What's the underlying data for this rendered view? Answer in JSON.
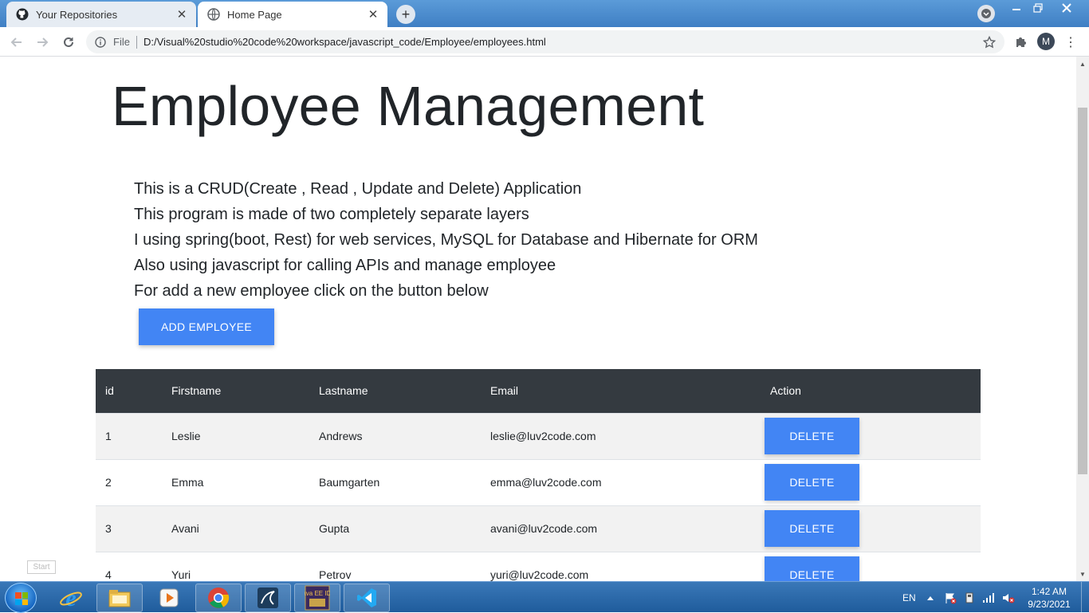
{
  "browser": {
    "tabs": [
      {
        "title": "Your Repositories",
        "icon": "github-icon",
        "active": false
      },
      {
        "title": "Home Page",
        "icon": "globe-icon",
        "active": true
      }
    ],
    "address": {
      "scheme_label": "File",
      "url": "D:/Visual%20studio%20code%20workspace/javascript_code/Employee/employees.html"
    },
    "profile_initial": "M"
  },
  "page": {
    "title": "Employee Management",
    "description": [
      "This is a CRUD(Create , Read , Update and Delete) Application",
      "This program is made of two completely separate layers",
      "I using spring(boot, Rest) for web services, MySQL for Database and Hibernate for ORM",
      "Also using javascript for calling APIs and manage employee",
      "For add a new employee click on the button below"
    ],
    "add_button_label": "ADD EMPLOYEE",
    "table": {
      "headers": [
        "id",
        "Firstname",
        "Lastname",
        "Email",
        "Action"
      ],
      "rows": [
        {
          "id": "1",
          "first": "Leslie",
          "last": "Andrews",
          "email": "leslie@luv2code.com",
          "action": "DELETE"
        },
        {
          "id": "2",
          "first": "Emma",
          "last": "Baumgarten",
          "email": "emma@luv2code.com",
          "action": "DELETE"
        },
        {
          "id": "3",
          "first": "Avani",
          "last": "Gupta",
          "email": "avani@luv2code.com",
          "action": "DELETE"
        },
        {
          "id": "4",
          "first": "Yuri",
          "last": "Petrov",
          "email": "yuri@luv2code.com",
          "action": "DELETE"
        }
      ]
    }
  },
  "overlay": {
    "start_tooltip": "Start"
  },
  "taskbar": {
    "language": "EN",
    "time": "1:42 AM",
    "date": "9/23/2021",
    "apps": [
      "internet-explorer-icon",
      "file-explorer-icon",
      "media-player-icon",
      "chrome-icon",
      "mysql-workbench-icon",
      "java-ee-ide-icon",
      "vscode-icon"
    ],
    "java_ide_label": "Java EE IDE"
  },
  "colors": {
    "accent": "#4285f4",
    "table_header": "#343a40",
    "text": "#212529"
  }
}
